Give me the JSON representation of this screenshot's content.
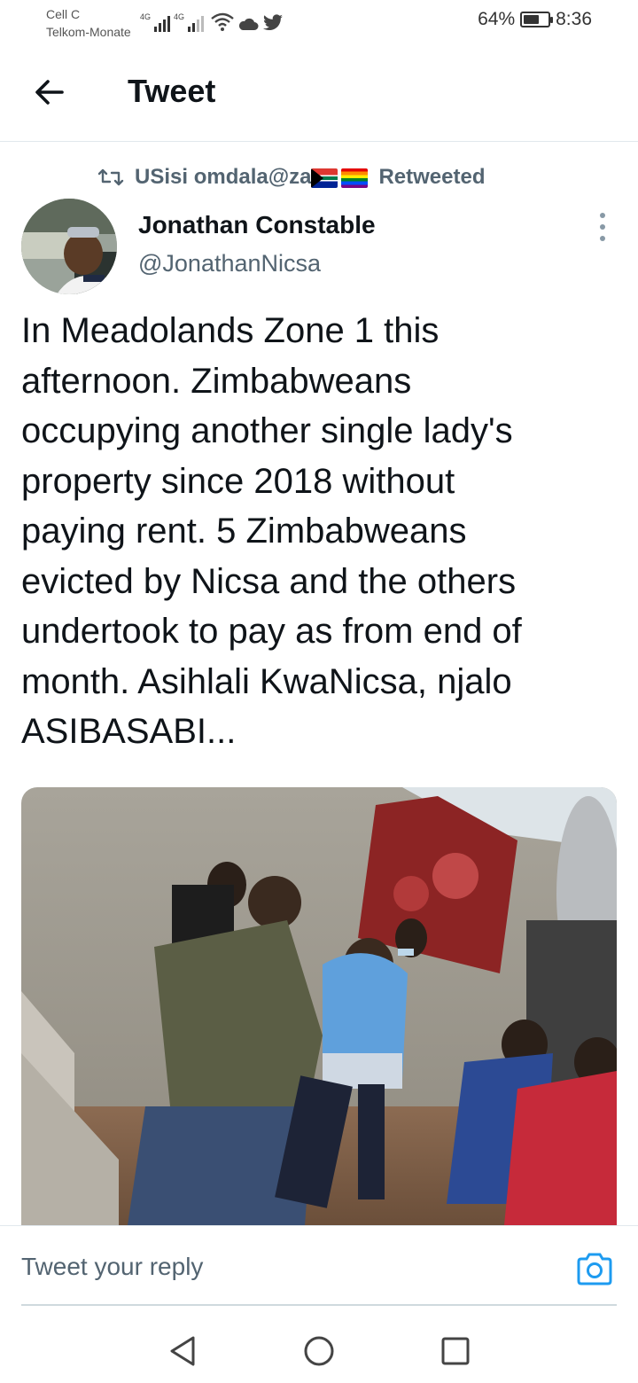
{
  "status_bar": {
    "carrier_1": "Cell C",
    "carrier_2": "Telkom-Monate",
    "network_1": "4G",
    "network_2": "4G",
    "battery": "64%",
    "battery_level": 0.64,
    "time": "8:36",
    "icons": [
      "signal-icon",
      "signal-icon",
      "wifi-icon",
      "cloud-icon",
      "twitter-bird-icon",
      "battery-icon"
    ]
  },
  "header": {
    "title": "Tweet",
    "back_icon": "arrow-left-icon"
  },
  "retweet": {
    "icon": "retweet-icon",
    "user": "USisi omdala@za",
    "flags": [
      "south-africa-flag",
      "rainbow-flag"
    ],
    "label": "Retweeted"
  },
  "tweet": {
    "author_name": "Jonathan Constable",
    "author_handle": "@JonathanNicsa",
    "more_icon": "more-vertical-icon",
    "text": "In Meadolands Zone 1 this\nafternoon. Zimbabweans\noccupying another single lady's\nproperty since 2018 without\npaying rent. 5 Zimbabweans\nevicted by Nicsa and the others\nundertook to pay as from end of\nmonth. Asihlali KwaNicsa, njalo\nASIBASABI..."
  },
  "reply": {
    "placeholder": "Tweet your reply",
    "camera_icon": "camera-icon"
  },
  "nav": {
    "back": "nav-back-icon",
    "home": "nav-home-icon",
    "recents": "nav-recents-icon"
  },
  "colors": {
    "text_primary": "#0f1419",
    "text_secondary": "#536471",
    "accent": "#1d9bf0",
    "divider": "#e1e8ed"
  }
}
